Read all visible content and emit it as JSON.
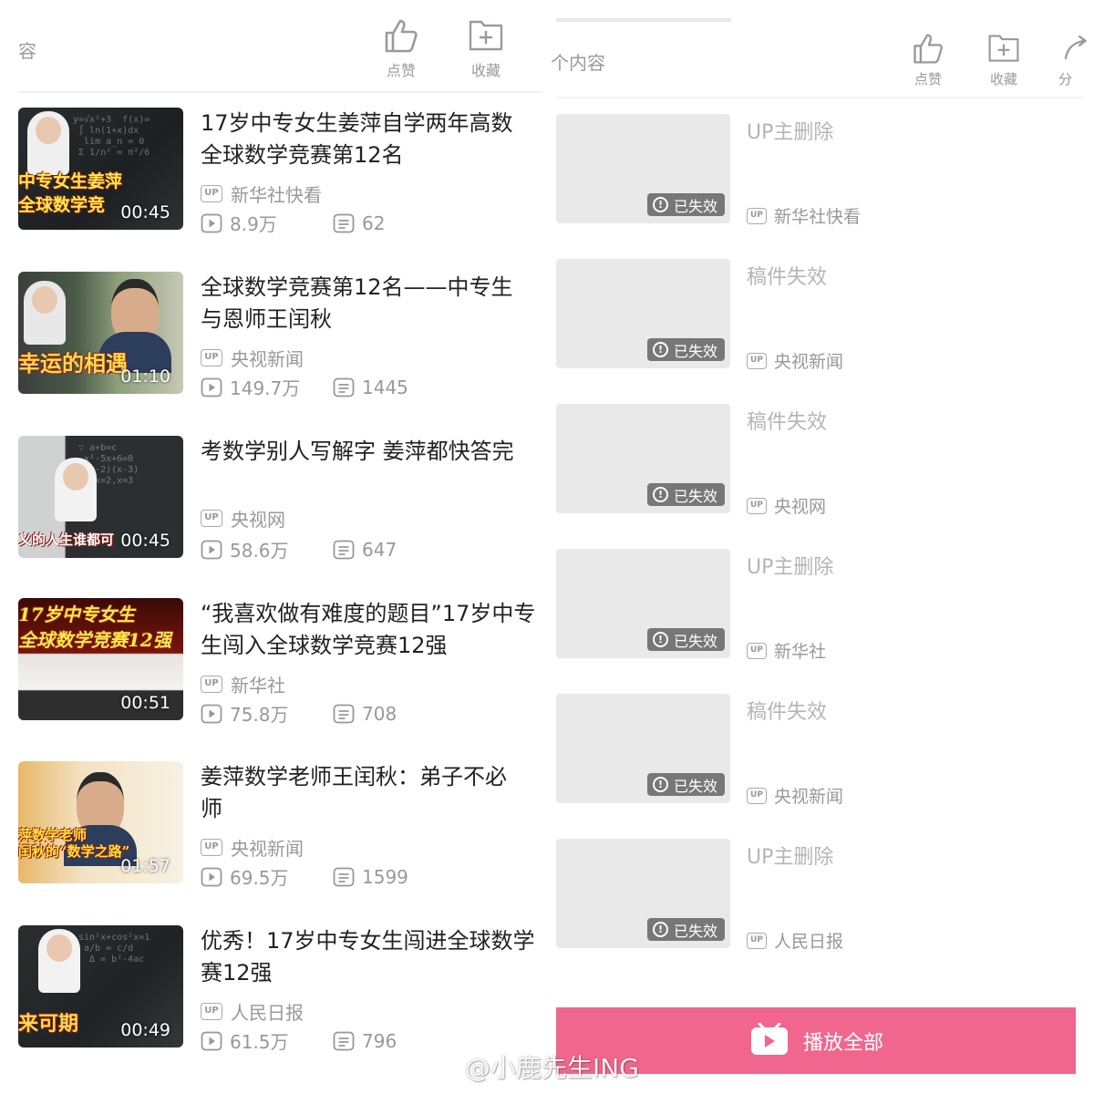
{
  "left_panel": {
    "header_fragment": "容",
    "actions": [
      {
        "label": "点赞",
        "icon": "thumb-up-icon"
      },
      {
        "label": "收藏",
        "icon": "favorite-folder-icon"
      }
    ],
    "videos": [
      {
        "title_line1": "17岁中专女生姜萍自学两年高数",
        "title_line2": "全球数学竞赛第12名",
        "uploader": "新华社快看",
        "plays": "8.9万",
        "comments": "62",
        "duration": "00:45",
        "overlay": "中专女生姜萍\n全球数学竞"
      },
      {
        "title_line1": "全球数学竞赛第12名——中专生",
        "title_line2": "与恩师王闰秋",
        "uploader": "央视新闻",
        "plays": "149.7万",
        "comments": "1445",
        "duration": "01:10",
        "overlay": "幸运的相遇"
      },
      {
        "title_line1": "考数学别人写解字 姜萍都快答完",
        "title_line2": "",
        "uploader": "央视网",
        "plays": "58.6万",
        "comments": "647",
        "duration": "00:45",
        "overlay": "义的人生谁都可"
      },
      {
        "title_line1": "“我喜欢做有难度的题目”17岁中专",
        "title_line2": "生闯入全球数学竞赛12强",
        "uploader": "新华社",
        "plays": "75.8万",
        "comments": "708",
        "duration": "00:51",
        "overlay": "17岁中专女生\n全球数学竞赛12强"
      },
      {
        "title_line1": "姜萍数学老师王闰秋：弟子不必",
        "title_line2": "师",
        "uploader": "央视新闻",
        "plays": "69.5万",
        "comments": "1599",
        "duration": "01:57",
        "overlay": "萍数学老师\n闰秋的“数学之路”"
      },
      {
        "title_line1": "优秀！17岁中专女生闯进全球数学",
        "title_line2": "赛12强",
        "uploader": "人民日报",
        "plays": "61.5万",
        "comments": "796",
        "duration": "00:49",
        "overlay": "来可期"
      }
    ]
  },
  "right_panel": {
    "header_fragment": "个内容",
    "actions": [
      {
        "label": "点赞",
        "icon": "thumb-up-icon"
      },
      {
        "label": "收藏",
        "icon": "favorite-folder-icon"
      },
      {
        "label": "分",
        "icon": "share-icon"
      }
    ],
    "invalid_badge": "已失效",
    "items": [
      {
        "status": "UP主删除",
        "uploader": "新华社快看"
      },
      {
        "status": "稿件失效",
        "uploader": "央视新闻"
      },
      {
        "status": "稿件失效",
        "uploader": "央视网"
      },
      {
        "status": "UP主删除",
        "uploader": "新华社"
      },
      {
        "status": "稿件失效",
        "uploader": "央视新闻"
      },
      {
        "status": "UP主删除",
        "uploader": "人民日报"
      }
    ],
    "play_all_label": "播放全部"
  },
  "up_badge": "UP",
  "watermark": "@小鹿先生ING",
  "colors": {
    "accent_pink": "#f0668f",
    "muted_text": "#999999",
    "invalid_badge_bg": "#777777"
  }
}
